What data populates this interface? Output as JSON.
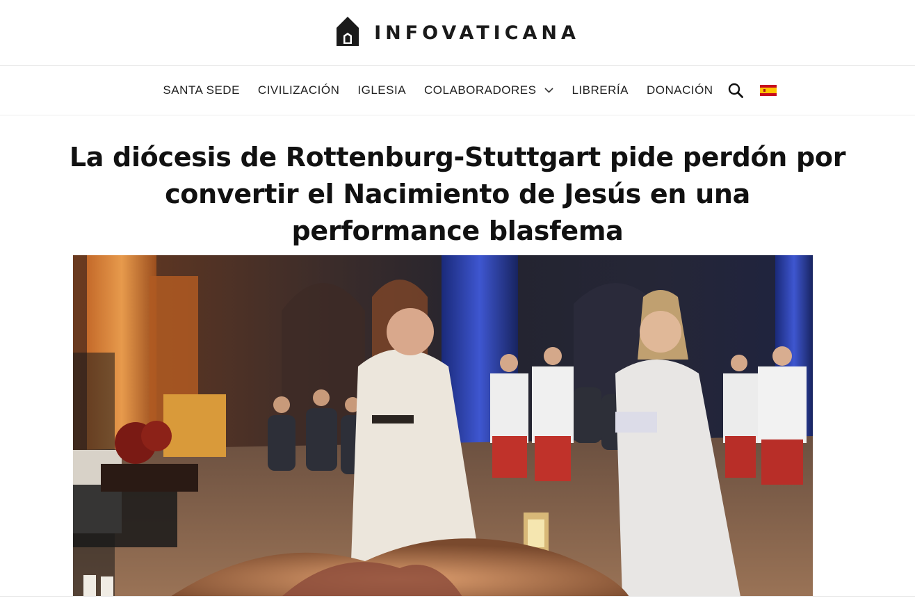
{
  "site": {
    "brand_name": "INFOVATICANA"
  },
  "nav": {
    "items": [
      "SANTA SEDE",
      "CIVILIZACIÓN",
      "IGLESIA",
      "COLABORADORES",
      "LIBRERÍA",
      "DONACIÓN"
    ],
    "has_dropdown": "COLABORADORES",
    "language_flag": "spain-flag-icon"
  },
  "article": {
    "title": "La diócesis de Rottenburg-Stuttgart pide perdón por convertir el Nacimiento de Jesús en una performance blasfema"
  },
  "colors": {
    "text": "#111111",
    "brand": "#1a1a1a"
  }
}
